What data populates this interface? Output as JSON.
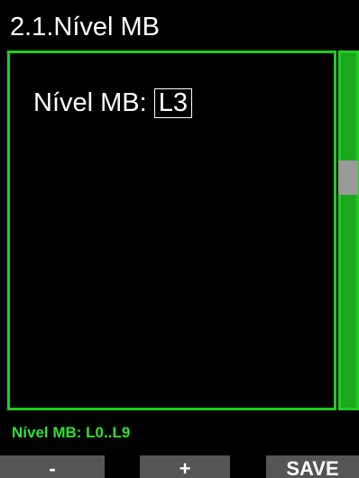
{
  "header": {
    "title": "2.1.Nível MB"
  },
  "setting": {
    "label": "Nível MB:",
    "value": "L3"
  },
  "hint": {
    "text": "Nível MB: L0..L9"
  },
  "softkeys": {
    "minus_label": "-",
    "plus_label": "+",
    "save_label": "SAVE"
  },
  "colors": {
    "accent_green": "#1fcc21",
    "hint_green": "#2ee22f",
    "softkey_gray": "#555555",
    "scroll_thumb_gray": "#9a9a9a",
    "background": "#000000"
  }
}
